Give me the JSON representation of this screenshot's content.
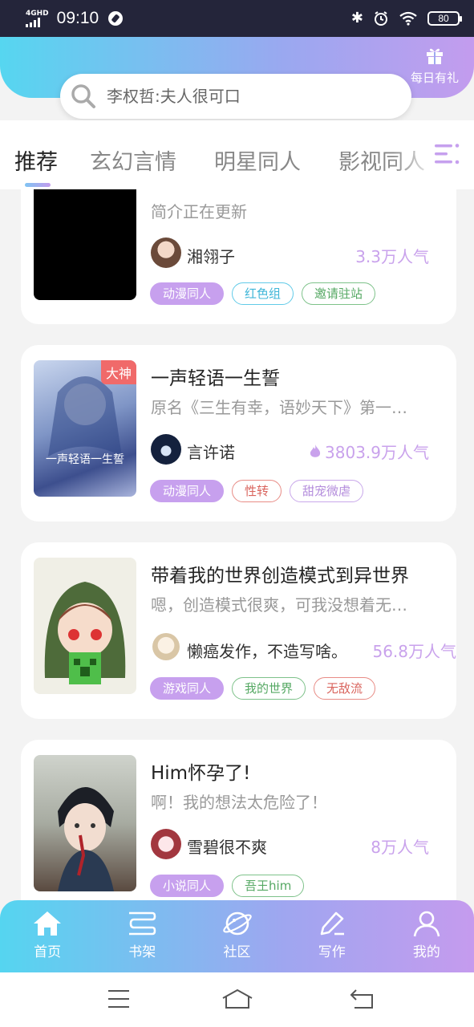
{
  "status_bar": {
    "network": "4GHD",
    "time": "09:10",
    "battery": "80"
  },
  "header": {
    "gift_label": "每日有礼"
  },
  "search": {
    "placeholder": "李权哲:夫人很可口"
  },
  "tabs": [
    {
      "label": "推荐",
      "active": true
    },
    {
      "label": "玄幻言情",
      "active": false
    },
    {
      "label": "明星同人",
      "active": false
    },
    {
      "label": "影视同人",
      "active": false
    }
  ],
  "books": [
    {
      "title": "",
      "desc": "简介正在更新",
      "author": "湘翎子",
      "popularity": "3.3万人气",
      "hot": false,
      "badge": "",
      "tags": [
        "动漫同人",
        "红色组",
        "邀请驻站"
      ]
    },
    {
      "title": "一声轻语一生誓",
      "desc": "原名《三生有幸，语妙天下》第一…",
      "author": "言许诺",
      "popularity": "3803.9万人气",
      "hot": true,
      "badge": "大神",
      "cover_text": "一声轻语一生誓",
      "tags": [
        "动漫同人",
        "性转",
        "甜宠微虐"
      ]
    },
    {
      "title": "带着我的世界创造模式到异世界",
      "desc": "嗯，创造模式很爽，可我没想着无…",
      "author": "懒癌发作，不造写啥。",
      "popularity": "56.8万人气",
      "hot": false,
      "badge": "",
      "tags": [
        "游戏同人",
        "我的世界",
        "无敌流"
      ]
    },
    {
      "title": "Him怀孕了!",
      "desc": "啊！我的想法太危险了！",
      "author": "雪碧很不爽",
      "popularity": "8万人气",
      "hot": false,
      "badge": "",
      "tags": [
        "小说同人",
        "吾王him"
      ]
    }
  ],
  "bottom_nav": [
    {
      "label": "首页",
      "icon": "home-icon"
    },
    {
      "label": "书架",
      "icon": "bookshelf-icon"
    },
    {
      "label": "社区",
      "icon": "planet-icon"
    },
    {
      "label": "写作",
      "icon": "pencil-icon"
    },
    {
      "label": "我的",
      "icon": "user-icon"
    }
  ],
  "colors": {
    "accent_cyan": "#56d6f0",
    "accent_purple": "#c39cee",
    "popularity": "#c9a2ec"
  }
}
